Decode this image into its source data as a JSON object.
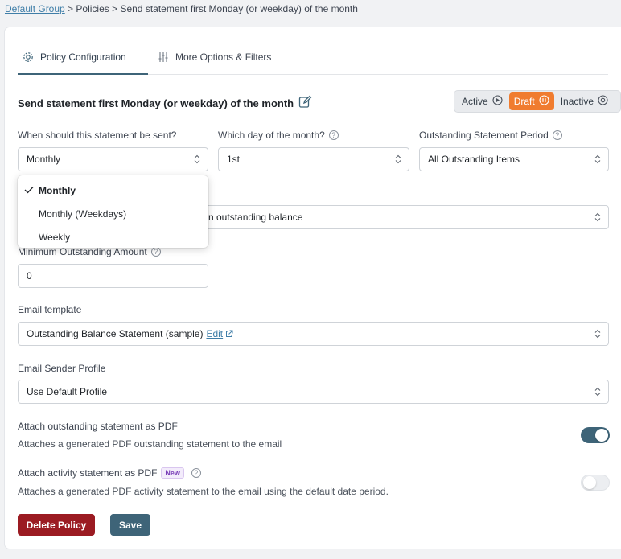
{
  "breadcrumb": {
    "group": "Default Group",
    "sep1": " > ",
    "policies": "Policies",
    "sep2": " > ",
    "current": "Send statement first Monday (or weekday) of the month"
  },
  "tabs": [
    {
      "label": "Policy Configuration",
      "icon": "gear-icon",
      "active": true
    },
    {
      "label": "More Options & Filters",
      "icon": "sliders-icon",
      "active": false
    }
  ],
  "policy_title": "Send statement first Monday (or weekday) of the month",
  "status": {
    "active": "Active",
    "draft": "Draft",
    "inactive": "Inactive",
    "selected": "Draft"
  },
  "fields": {
    "when": {
      "label": "When should this statement be sent?",
      "value": "Monthly"
    },
    "day": {
      "label": "Which day of the month?",
      "value": "1st"
    },
    "period": {
      "label": "Outstanding Statement Period",
      "value": "All Outstanding Items"
    },
    "recipients": {
      "value": "n outstanding balance"
    },
    "min_amount": {
      "label": "Minimum Outstanding Amount",
      "value": "0"
    },
    "template": {
      "label": "Email template",
      "value": "Outstanding Balance Statement (sample)",
      "edit": "Edit"
    },
    "sender": {
      "label": "Email Sender Profile",
      "value": "Use Default Profile"
    }
  },
  "frequency_options": [
    {
      "label": "Monthly",
      "selected": true
    },
    {
      "label": "Monthly (Weekdays)",
      "selected": false
    },
    {
      "label": "Weekly",
      "selected": false
    }
  ],
  "attach_outstanding": {
    "label": "Attach outstanding statement as PDF",
    "desc": "Attaches a generated PDF outstanding statement to the email",
    "enabled": true
  },
  "attach_activity": {
    "label": "Attach activity statement as PDF",
    "badge": "New",
    "desc": "Attaches a generated PDF activity statement to the email using the default date period.",
    "enabled": false
  },
  "buttons": {
    "delete": "Delete Policy",
    "save": "Save"
  },
  "colors": {
    "accent": "#3e6478",
    "draft": "#f07c2f",
    "delete": "#9b1b22",
    "link": "#3f7ea8"
  }
}
